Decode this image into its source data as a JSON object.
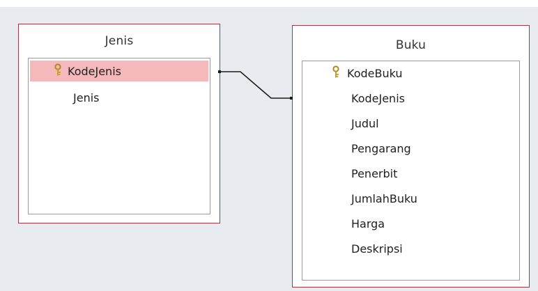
{
  "tables": {
    "jenis": {
      "title": "Jenis",
      "fields": [
        {
          "name": "KodeJenis",
          "primary_key": true,
          "selected": true
        },
        {
          "name": "Jenis",
          "primary_key": false,
          "selected": false
        }
      ]
    },
    "buku": {
      "title": "Buku",
      "fields": [
        {
          "name": "KodeBuku",
          "primary_key": true,
          "selected": false
        },
        {
          "name": "KodeJenis",
          "primary_key": false,
          "selected": false
        },
        {
          "name": "Judul",
          "primary_key": false,
          "selected": false
        },
        {
          "name": "Pengarang",
          "primary_key": false,
          "selected": false
        },
        {
          "name": "Penerbit",
          "primary_key": false,
          "selected": false
        },
        {
          "name": "JumlahBuku",
          "primary_key": false,
          "selected": false
        },
        {
          "name": "Harga",
          "primary_key": false,
          "selected": false
        },
        {
          "name": "Deskripsi",
          "primary_key": false,
          "selected": false
        }
      ]
    }
  },
  "relationship": {
    "from": "Jenis.KodeJenis",
    "to": "Buku.KodeJenis"
  },
  "colors": {
    "workspace_bg": "#e8ebef",
    "table_border": "#a4373f",
    "selected_row": "#f5b9bb",
    "key_icon": "#c9a227"
  },
  "icons": {
    "primary_key": "key-icon"
  }
}
